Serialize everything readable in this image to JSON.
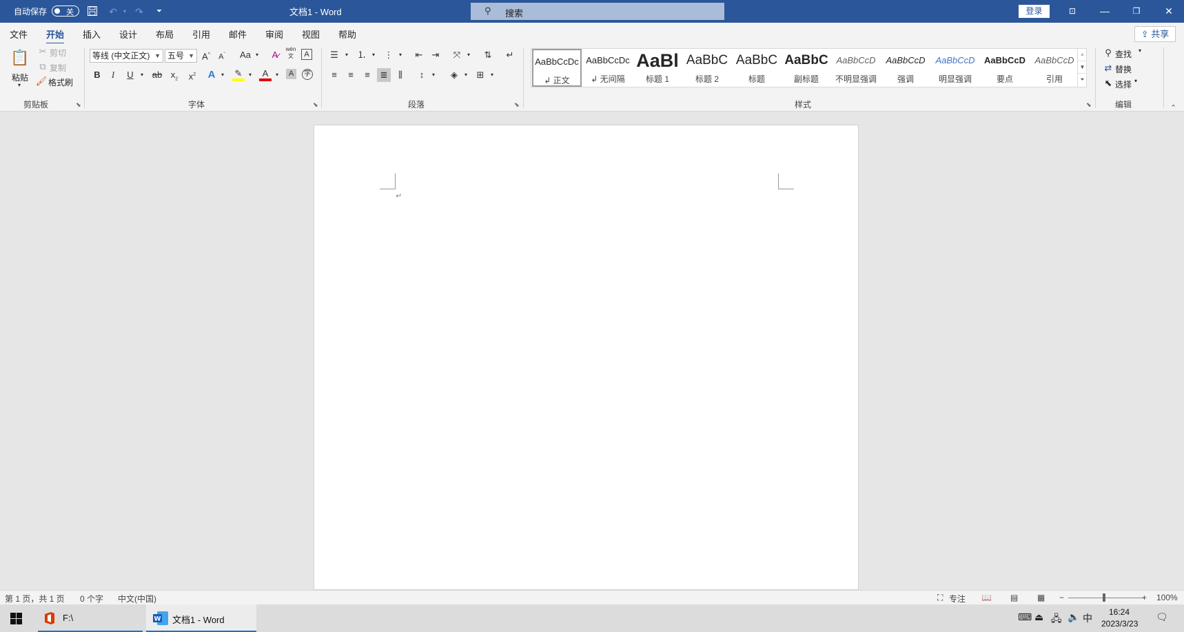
{
  "titlebar": {
    "autosave_label": "自动保存",
    "autosave_state": "关",
    "doc_title": "文档1  -  Word",
    "search_placeholder": "搜索",
    "login_label": "登录"
  },
  "tabs": [
    "文件",
    "开始",
    "插入",
    "设计",
    "布局",
    "引用",
    "邮件",
    "审阅",
    "视图",
    "帮助"
  ],
  "active_tab": "开始",
  "share_label": "共享",
  "clipboard": {
    "paste": "粘贴",
    "cut": "剪切",
    "copy": "复制",
    "format_painter": "格式刷",
    "group": "剪贴板"
  },
  "font": {
    "family": "等线 (中文正文)",
    "size": "五号",
    "case_label": "Aa",
    "bold": "B",
    "italic": "I",
    "underline": "U",
    "strike": "ab",
    "sub": "x",
    "sup": "x",
    "group": "字体",
    "pinyin": "wén",
    "pinyin_char": "文"
  },
  "paragraph": {
    "group": "段落"
  },
  "styles": {
    "group": "样式",
    "items": [
      {
        "preview": "AaBbCcDc",
        "name": "↲ 正文"
      },
      {
        "preview": "AaBbCcDc",
        "name": "↲ 无间隔"
      },
      {
        "preview": "AaBl",
        "name": "标题 1"
      },
      {
        "preview": "AaBbC",
        "name": "标题 2"
      },
      {
        "preview": "AaBbC",
        "name": "标题"
      },
      {
        "preview": "AaBbC",
        "name": "副标题"
      },
      {
        "preview": "AaBbCcD",
        "name": "不明显强调"
      },
      {
        "preview": "AaBbCcD",
        "name": "强调"
      },
      {
        "preview": "AaBbCcD",
        "name": "明显强调"
      },
      {
        "preview": "AaBbCcD",
        "name": "要点"
      },
      {
        "preview": "AaBbCcD",
        "name": "引用"
      }
    ]
  },
  "editing": {
    "find": "查找",
    "replace": "替换",
    "select": "选择",
    "group": "编辑"
  },
  "document": {
    "para_mark": "↵"
  },
  "status": {
    "page": "第 1 页，共 1 页",
    "words": "0 个字",
    "lang": "中文(中国)",
    "focus": "专注",
    "zoom": "100%"
  },
  "taskbar": {
    "explorer_label": "F:\\",
    "word_label": "文档1 - Word",
    "ime": "中",
    "time": "16:24",
    "date": "2023/3/23"
  },
  "colors": {
    "accent": "#2b579a",
    "highlight": "#ffff00",
    "font_color": "#e00000"
  }
}
